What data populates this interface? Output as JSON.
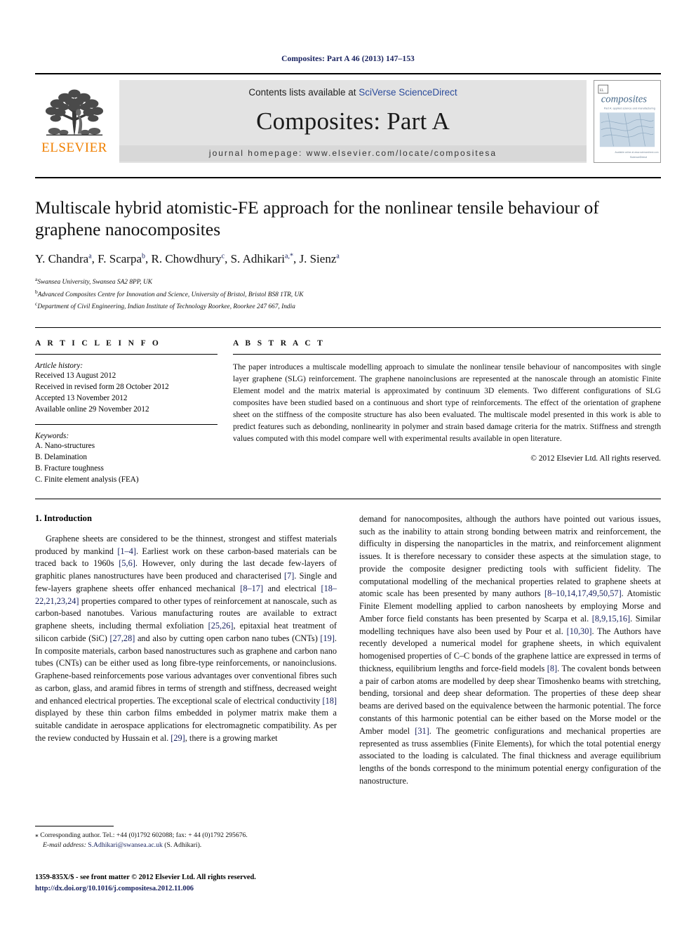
{
  "running_head": "Composites: Part A 46 (2013) 147–153",
  "masthead": {
    "contents_prefix": "Contents lists available at ",
    "sciencedirect_link": "SciVerse ScienceDirect",
    "journal_title": "Composites: Part A",
    "homepage": "journal homepage: www.elsevier.com/locate/compositesa",
    "publisher_name": "ELSEVIER",
    "cover_title": "composites",
    "cover_subtitle": "Part A: Applied Science and Manufacturing"
  },
  "title": "Multiscale hybrid atomistic-FE approach for the nonlinear tensile behaviour of graphene nanocomposites",
  "authors": [
    {
      "name": "Y. Chandra",
      "sup": "a"
    },
    {
      "name": "F. Scarpa",
      "sup": "b"
    },
    {
      "name": "R. Chowdhury",
      "sup": "c"
    },
    {
      "name": "S. Adhikari",
      "sup": "a,*"
    },
    {
      "name": "J. Sienz",
      "sup": "a"
    }
  ],
  "affiliations": [
    {
      "sup": "a",
      "text": "Swansea University, Swansea SA2 8PP, UK"
    },
    {
      "sup": "b",
      "text": "Advanced Composites Centre for Innovation and Science, University of Bristol, Bristol BS8 1TR, UK"
    },
    {
      "sup": "c",
      "text": "Department of Civil Engineering, Indian Institute of Technology Roorkee, Roorkee 247 667, India"
    }
  ],
  "article_info": {
    "heading": "A R T I C L E   I N F O",
    "history_label": "Article history:",
    "history": [
      "Received 13 August 2012",
      "Received in revised form 28 October 2012",
      "Accepted 13 November 2012",
      "Available online 29 November 2012"
    ],
    "keywords_label": "Keywords:",
    "keywords": [
      "A. Nano-structures",
      "B. Delamination",
      "B. Fracture toughness",
      "C. Finite element analysis (FEA)"
    ]
  },
  "abstract": {
    "heading": "A B S T R A C T",
    "body": "The paper introduces a multiscale modelling approach to simulate the nonlinear tensile behaviour of nancomposites with single layer graphene (SLG) reinforcement. The graphene nanoinclusions are represented at the nanoscale through an atomistic Finite Element model and the matrix material is approximated by continuum 3D elements. Two different configurations of SLG composites have been studied based on a continuous and short type of reinforcements. The effect of the orientation of graphene sheet on the stiffness of the composite structure has also been evaluated. The multiscale model presented in this work is able to predict features such as debonding, nonlinearity in polymer and strain based damage criteria for the matrix. Stiffness and strength values computed with this model compare well with experimental results available in open literature.",
    "copyright": "© 2012 Elsevier Ltd. All rights reserved."
  },
  "introduction": {
    "heading": "1. Introduction",
    "left_column_html": "Graphene sheets are considered to be the thinnest, strongest and stiffest materials produced by mankind <span class=\"cit\">[1–4]</span>. Earliest work on these carbon-based materials can be traced back to 1960s <span class=\"cit\">[5,6]</span>. However, only during the last decade few-layers of graphitic planes nanostructures have been produced and characterised <span class=\"cit\">[7]</span>. Single and few-layers graphene sheets offer enhanced mechanical <span class=\"cit\">[8–17]</span> and electrical <span class=\"cit\">[18–22,21,23,24]</span> properties compared to other types of reinforcement at nanoscale, such as carbon-based nanotubes. Various manufacturing routes are available to extract graphene sheets, including thermal exfoliation <span class=\"cit\">[25,26]</span>, epitaxial heat treatment of silicon carbide (SiC) <span class=\"cit\">[27,28]</span> and also by cutting open carbon nano tubes (CNTs) <span class=\"cit\">[19]</span>. In composite materials, carbon based nanostructures such as graphene and carbon nano tubes (CNTs) can be either used as long fibre-type reinforcements, or nanoinclusions. Graphene-based reinforcements pose various advantages over conventional fibres such as carbon, glass, and aramid fibres in terms of strength and stiffness, decreased weight and enhanced electrical properties. The exceptional scale of electrical conductivity <span class=\"cit\">[18]</span> displayed by these thin carbon films embedded in polymer matrix make them a suitable candidate in aerospace applications for electromagnetic compatibility. As per the review conducted by Hussain et al. <span class=\"cit\">[29]</span>, there is a growing market",
    "right_column_html": "demand for nanocomposites, although the authors have pointed out various issues, such as the inability to attain strong bonding between matrix and reinforcement, the difficulty in dispersing the nanoparticles in the matrix, and reinforcement alignment issues. It is therefore necessary to consider these aspects at the simulation stage, to provide the composite designer predicting tools with sufficient fidelity. The computational modelling of the mechanical properties related to graphene sheets at atomic scale has been presented by many authors <span class=\"cit\">[8–10,14,17,49,50,57]</span>. Atomistic Finite Element modelling applied to carbon nanosheets by employing Morse and Amber force field constants has been presented by Scarpa et al. <span class=\"cit\">[8,9,15,16]</span>. Similar modelling techniques have also been used by Pour et al. <span class=\"cit\">[10,30]</span>. The Authors have recently developed a numerical model for graphene sheets, in which equivalent homogenised properties of C–C bonds of the graphene lattice are expressed in terms of thickness, equilibrium lengths and force-field models <span class=\"cit\">[8]</span>. The covalent bonds between a pair of carbon atoms are modelled by deep shear Timoshenko beams with stretching, bending, torsional and deep shear deformation. The properties of these deep shear beams are derived based on the equivalence between the harmonic potential. The force constants of this harmonic potential can be either based on the Morse model or the Amber model <span class=\"cit\">[31]</span>. The geometric configurations and mechanical properties are represented as truss assemblies (Finite Elements), for which the total potential energy associated to the loading is calculated. The final thickness and average equilibrium lengths of the bonds correspond to the minimum potential energy configuration of the nanostructure."
  },
  "footnotes": {
    "corresponding_marker": "⁎",
    "corresponding": "Corresponding author. Tel.: +44 (0)1792 602088; fax: + 44 (0)1792 295676.",
    "email_label": "E-mail address:",
    "email": "S.Adhikari@swansea.ac.uk",
    "email_suffix": "(S. Adhikari)."
  },
  "footer": {
    "issn_line": "1359-835X/$ - see front matter © 2012 Elsevier Ltd. All rights reserved.",
    "doi": "http://dx.doi.org/10.1016/j.compositesa.2012.11.006"
  },
  "colors": {
    "link": "#16205e",
    "sciencedirect": "#2b4b9b",
    "elsevier_orange": "#f08000",
    "masthead_bg": "#e3e3e3"
  }
}
